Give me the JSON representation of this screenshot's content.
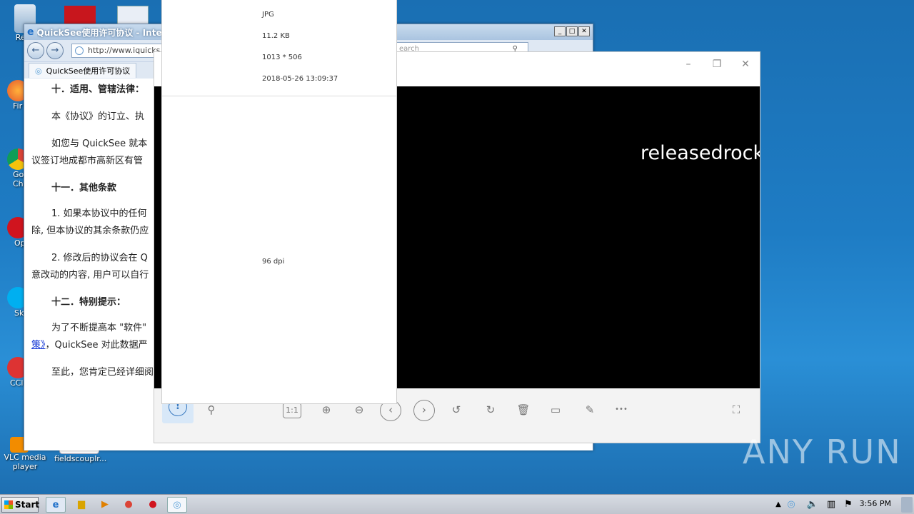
{
  "desktop": {
    "icons": [
      {
        "label": "Recy",
        "icon": "recycle-bin-icon"
      },
      {
        "label": "Fir",
        "icon": "firefox-icon"
      },
      {
        "label": "Go\nChr",
        "icon": "chrome-icon"
      },
      {
        "label": "Op",
        "icon": "opera-icon"
      },
      {
        "label": "Sk",
        "icon": "skype-icon"
      },
      {
        "label": "CCl",
        "icon": "ccleaner-icon"
      },
      {
        "label": "VLC media player",
        "icon": "vlc-icon"
      },
      {
        "label": "fieldscouplr...",
        "icon": "file-icon"
      }
    ]
  },
  "ie_window": {
    "title": "QuickSee使用许可协议 - Inter",
    "address": "http://www.iquicks",
    "search_placeholder": "earch",
    "tab_label": "QuickSee使用许可协议",
    "content": {
      "p1": "十．适用、管辖法律：",
      "p2": "本《协议》的订立、执",
      "p3": "如您与 QuickSee 就本",
      "p4": "议签订地成都市高新区有管",
      "p5": "十一．其他条款",
      "p6": "1. 如果本协议中的任何",
      "p7": "除, 但本协议的其余条款仍应",
      "p8": "2. 修改后的协议会在 Q",
      "p9": "意改动的内容, 用户可以自行",
      "p10": "十二．特别提示：",
      "p11": "为了不断提高本 \"软件\"",
      "p12_link": "策》",
      "p12_rest": "，QuickSee 对此数据严",
      "p13": "至此，您肯定已经详细阅"
    }
  },
  "viewer": {
    "overlay_text": "releasedrock",
    "toolbar": {
      "one_to_one": "1:1",
      "more": "•••"
    }
  },
  "info_panel": {
    "format": "JPG",
    "size": "11.2 KB",
    "dimensions": "1013 * 506",
    "date": "2018-05-26 13:09:37",
    "dpi": "96 dpi"
  },
  "taskbar": {
    "start": "Start",
    "clock": "3:56 PM"
  },
  "watermark": "ANY RUN"
}
